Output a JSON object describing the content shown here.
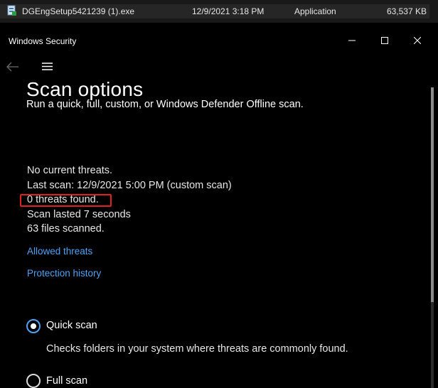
{
  "file_row": {
    "name": "DGEngSetup5421239 (1).exe",
    "date": "12/9/2021 3:18 PM",
    "type": "Application",
    "size": "63,537 KB"
  },
  "window": {
    "title": "Windows Security",
    "minimize": "—",
    "maximize": "☐",
    "close": "✕"
  },
  "page": {
    "title": "Scan options",
    "subtitle": "Run a quick, full, custom, or Windows Defender Offline scan.",
    "status": {
      "current": "No current threats.",
      "last_scan": "Last scan: 12/9/2021 5:00 PM (custom scan)",
      "threats_found": "0 threats found.",
      "duration": "Scan lasted 7 seconds",
      "files": "63 files scanned."
    },
    "links": {
      "allowed": "Allowed threats",
      "history": "Protection history"
    },
    "scan_types": [
      {
        "label": "Quick scan",
        "description": "Checks folders in your system where threats are commonly found.",
        "selected": true
      },
      {
        "label": "Full scan",
        "selected": false
      }
    ]
  },
  "colors": {
    "accent": "#4ca2f4",
    "highlight": "#e0201b",
    "background": "#000000"
  }
}
